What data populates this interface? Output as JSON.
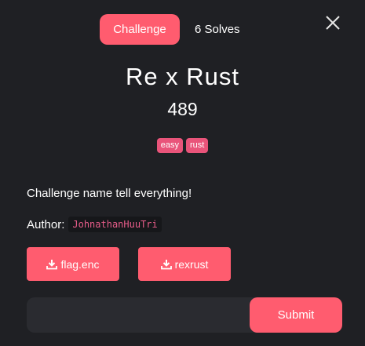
{
  "tabs": {
    "challenge": "Challenge",
    "solves": "6 Solves"
  },
  "close_icon": "close-icon",
  "challenge": {
    "name": "Re x Rust",
    "points": "489",
    "tags": [
      "easy",
      "rust"
    ],
    "description": "Challenge name tell everything!",
    "author_label": "Author:",
    "author_name": "JohnathanHuuTri"
  },
  "files": [
    {
      "label": "flag.enc",
      "icon": "download-icon"
    },
    {
      "label": "rexrust",
      "icon": "download-icon"
    }
  ],
  "flag_input": {
    "placeholder": "",
    "value": ""
  },
  "submit_label": "Submit",
  "colors": {
    "background": "#1f2024",
    "accent": "#ff5c6f",
    "tag": "#e9547a",
    "code_text": "#e85d8a"
  }
}
